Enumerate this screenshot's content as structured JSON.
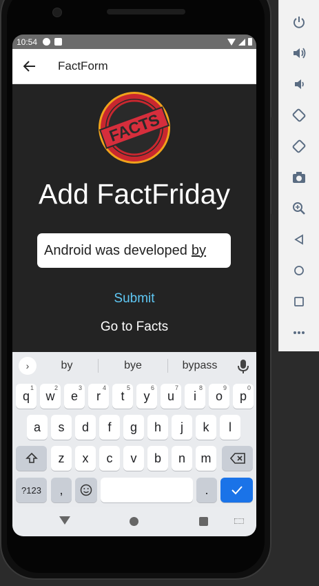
{
  "status_bar": {
    "time": "10:54"
  },
  "app_bar": {
    "title": "FactForm"
  },
  "logo": {
    "text": "FACTS"
  },
  "main": {
    "heading": "Add FactFriday",
    "input_value": "Android was developed",
    "input_value_underlined": "by",
    "submit_label": "Submit",
    "goto_label": "Go to Facts"
  },
  "keyboard": {
    "suggestions": [
      "by",
      "bye",
      "bypass"
    ],
    "row1": [
      {
        "k": "q",
        "s": "1"
      },
      {
        "k": "w",
        "s": "2"
      },
      {
        "k": "e",
        "s": "3"
      },
      {
        "k": "r",
        "s": "4"
      },
      {
        "k": "t",
        "s": "5"
      },
      {
        "k": "y",
        "s": "6"
      },
      {
        "k": "u",
        "s": "7"
      },
      {
        "k": "i",
        "s": "8"
      },
      {
        "k": "o",
        "s": "9"
      },
      {
        "k": "p",
        "s": "0"
      }
    ],
    "row2": [
      "a",
      "s",
      "d",
      "f",
      "g",
      "h",
      "j",
      "k",
      "l"
    ],
    "row3": [
      "z",
      "x",
      "c",
      "v",
      "b",
      "n",
      "m"
    ],
    "symbols_label": "?123",
    "comma_label": ",",
    "period_label": "."
  },
  "colors": {
    "screen_bg": "#232323",
    "accent": "#5fc8f5",
    "enter_key": "#1a73e8",
    "logo_red": "#d62e3c",
    "logo_ring": "#f0a21b"
  },
  "emulator_toolbar": {
    "icons": [
      "power-icon",
      "volume-up-icon",
      "volume-down-icon",
      "rotate-left-icon",
      "rotate-right-icon",
      "camera-icon",
      "zoom-icon",
      "back-icon",
      "home-icon",
      "overview-icon",
      "more-icon"
    ]
  }
}
